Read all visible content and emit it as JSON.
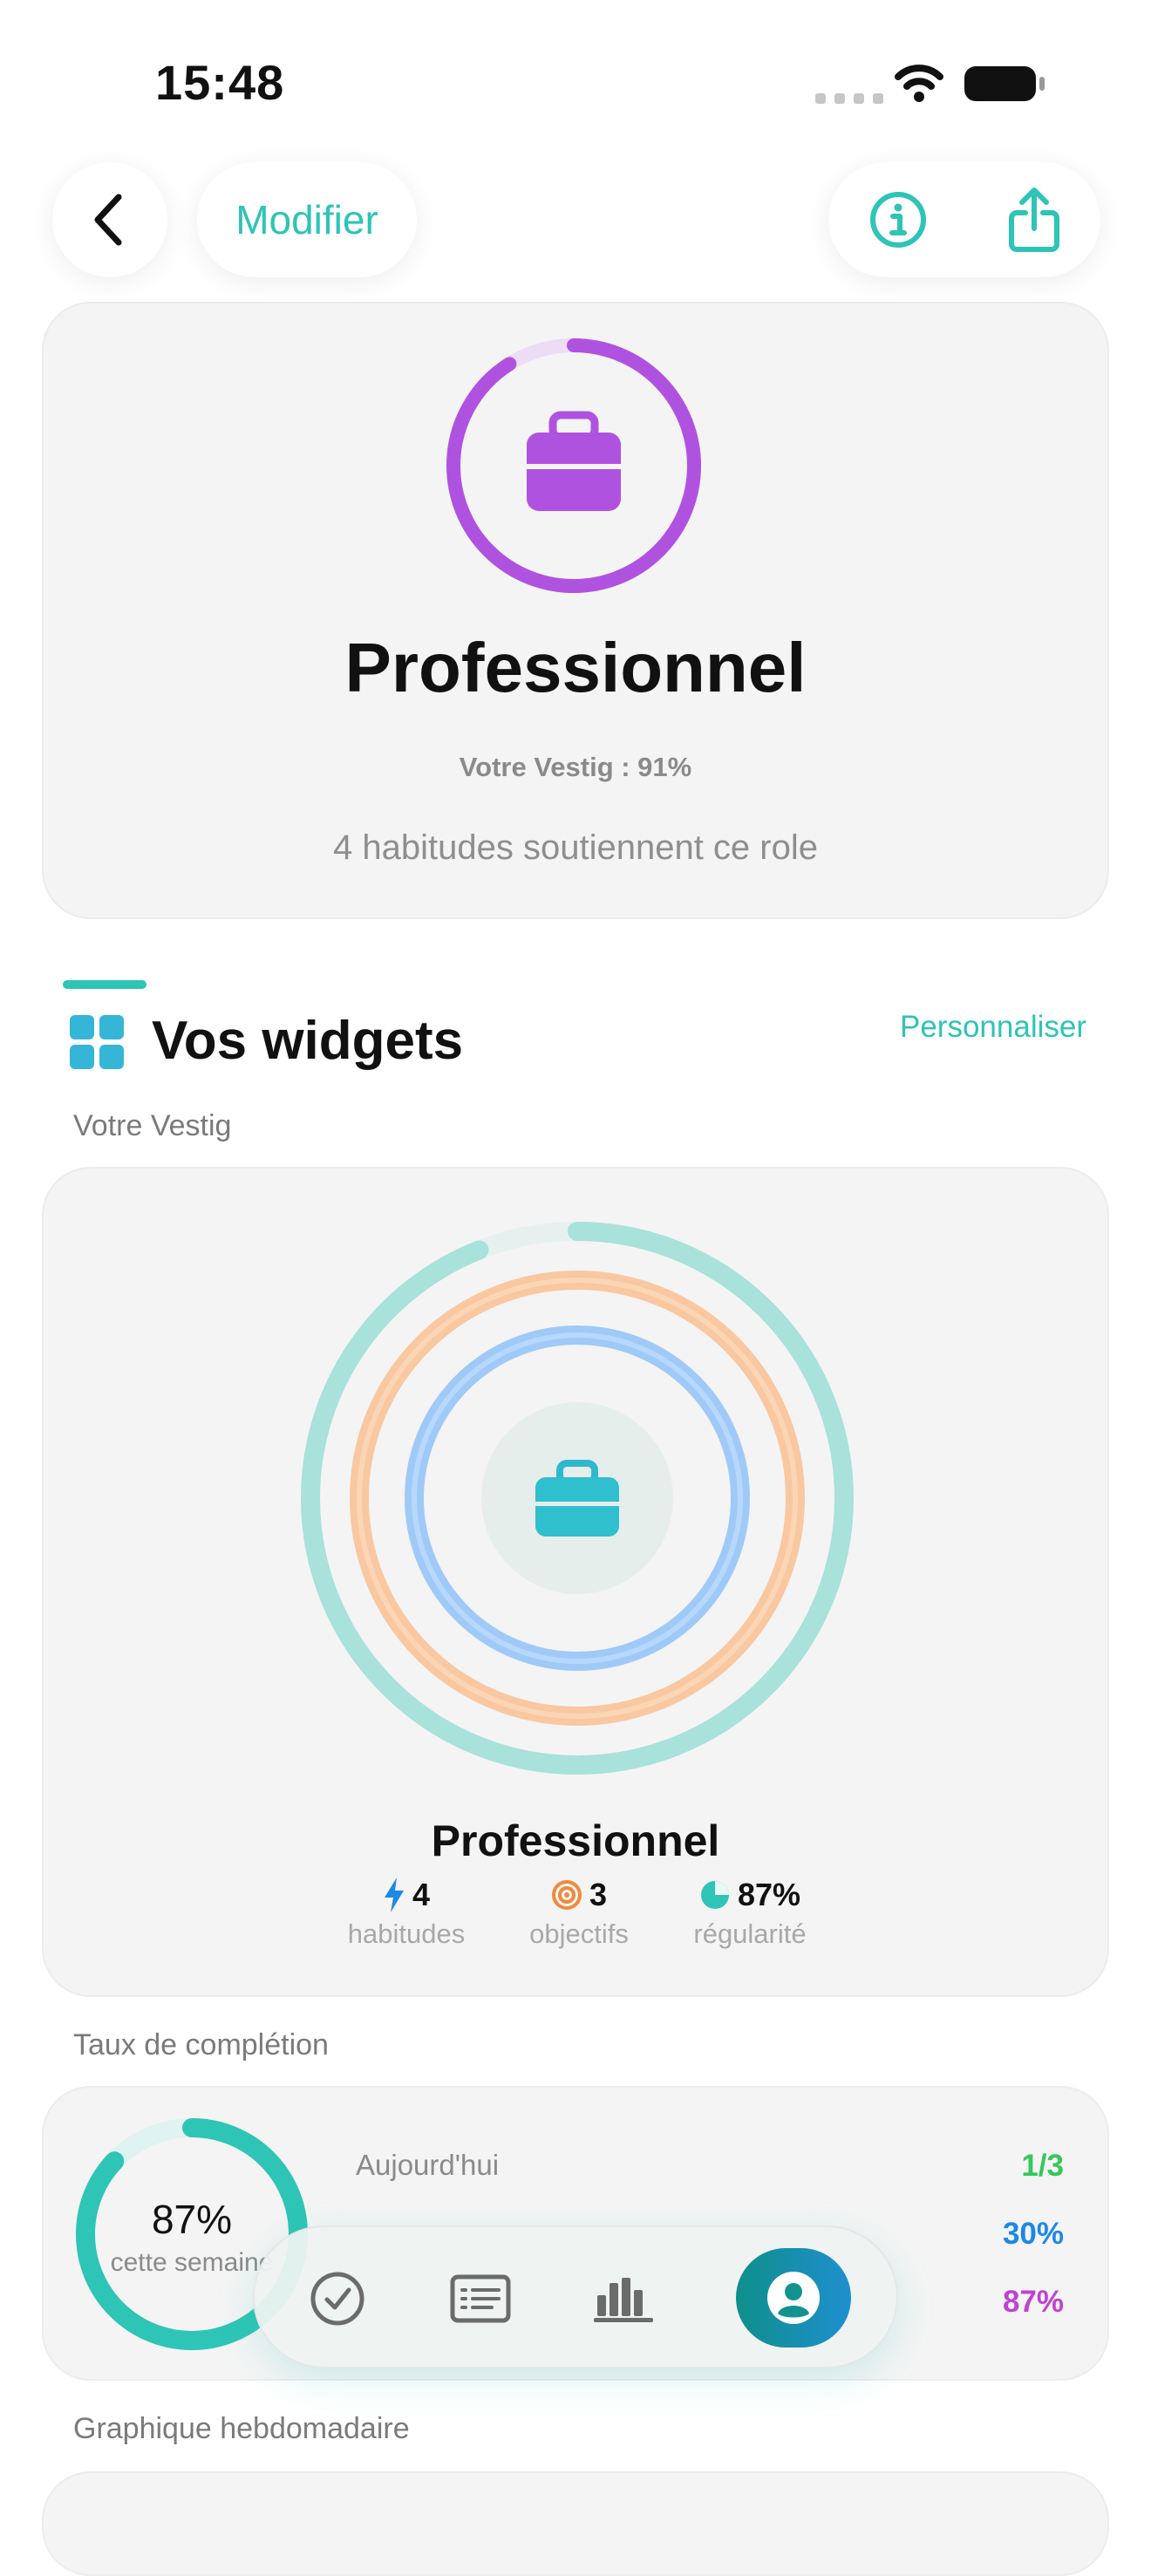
{
  "status_bar": {
    "time": "15:48"
  },
  "nav": {
    "back_icon": "chevron-left-icon",
    "edit_label": "Modifier",
    "info_icon": "info-circle-icon",
    "share_icon": "share-icon"
  },
  "role": {
    "icon": "briefcase-icon",
    "title": "Professionnel",
    "score_text": "Votre Vestig : 91%",
    "score_fraction": 0.91,
    "habits_text": "4 habitudes soutiennent ce role",
    "accent_color": "#b052e0"
  },
  "widgets": {
    "title": "Vos widgets",
    "customize_label": "Personnaliser",
    "vestig_label": "Votre Vestig",
    "vestig_card": {
      "role_name": "Professionnel",
      "stats": [
        {
          "icon": "bolt-icon",
          "value": "4",
          "label": "habitudes"
        },
        {
          "icon": "target-icon",
          "value": "3",
          "label": "objectifs"
        },
        {
          "icon": "pie-chart-icon",
          "value": "87%",
          "label": "régularité"
        }
      ],
      "rings": [
        {
          "color": "#a8e2da",
          "fraction": 0.94
        },
        {
          "color": "#f9c8a0",
          "fraction": 1.0
        },
        {
          "color": "#9fcaf8",
          "fraction": 1.0
        }
      ]
    },
    "completion_label": "Taux de complétion",
    "completion_card": {
      "percent": "87%",
      "sublabel": "cette semaine",
      "fraction": 0.87,
      "rows": [
        {
          "label": "Aujourd'hui",
          "value": "1/3",
          "color": "#34c759"
        },
        {
          "label": "",
          "value": "30%",
          "color": "#1e88e5"
        },
        {
          "label": "",
          "value": "87%",
          "color": "#c042d0"
        }
      ]
    },
    "weekly_label": "Graphique hebdomadaire"
  },
  "tab_bar": {
    "items": [
      {
        "icon": "check-circle-icon",
        "active": false
      },
      {
        "icon": "list-icon",
        "active": false
      },
      {
        "icon": "bar-chart-icon",
        "active": false
      },
      {
        "icon": "profile-icon",
        "active": true
      }
    ]
  }
}
